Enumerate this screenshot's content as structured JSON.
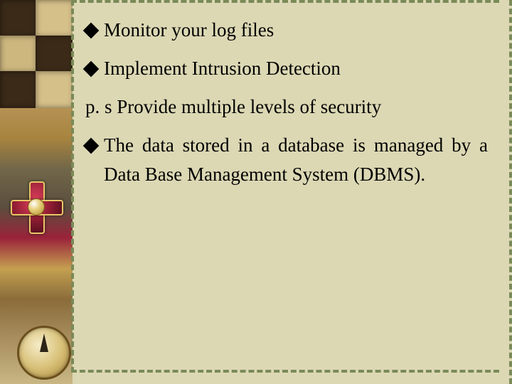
{
  "slide": {
    "bullets": [
      {
        "type": "diamond",
        "text": "Monitor your log files"
      },
      {
        "type": "diamond",
        "text": "Implement Intrusion Detection"
      },
      {
        "type": "ps",
        "prefix": "p. s ",
        "text": "Provide multiple levels of security"
      },
      {
        "type": "diamond",
        "text": "The data stored in a database is managed by a Data Base Management System (DBMS).",
        "justify": true
      }
    ]
  }
}
